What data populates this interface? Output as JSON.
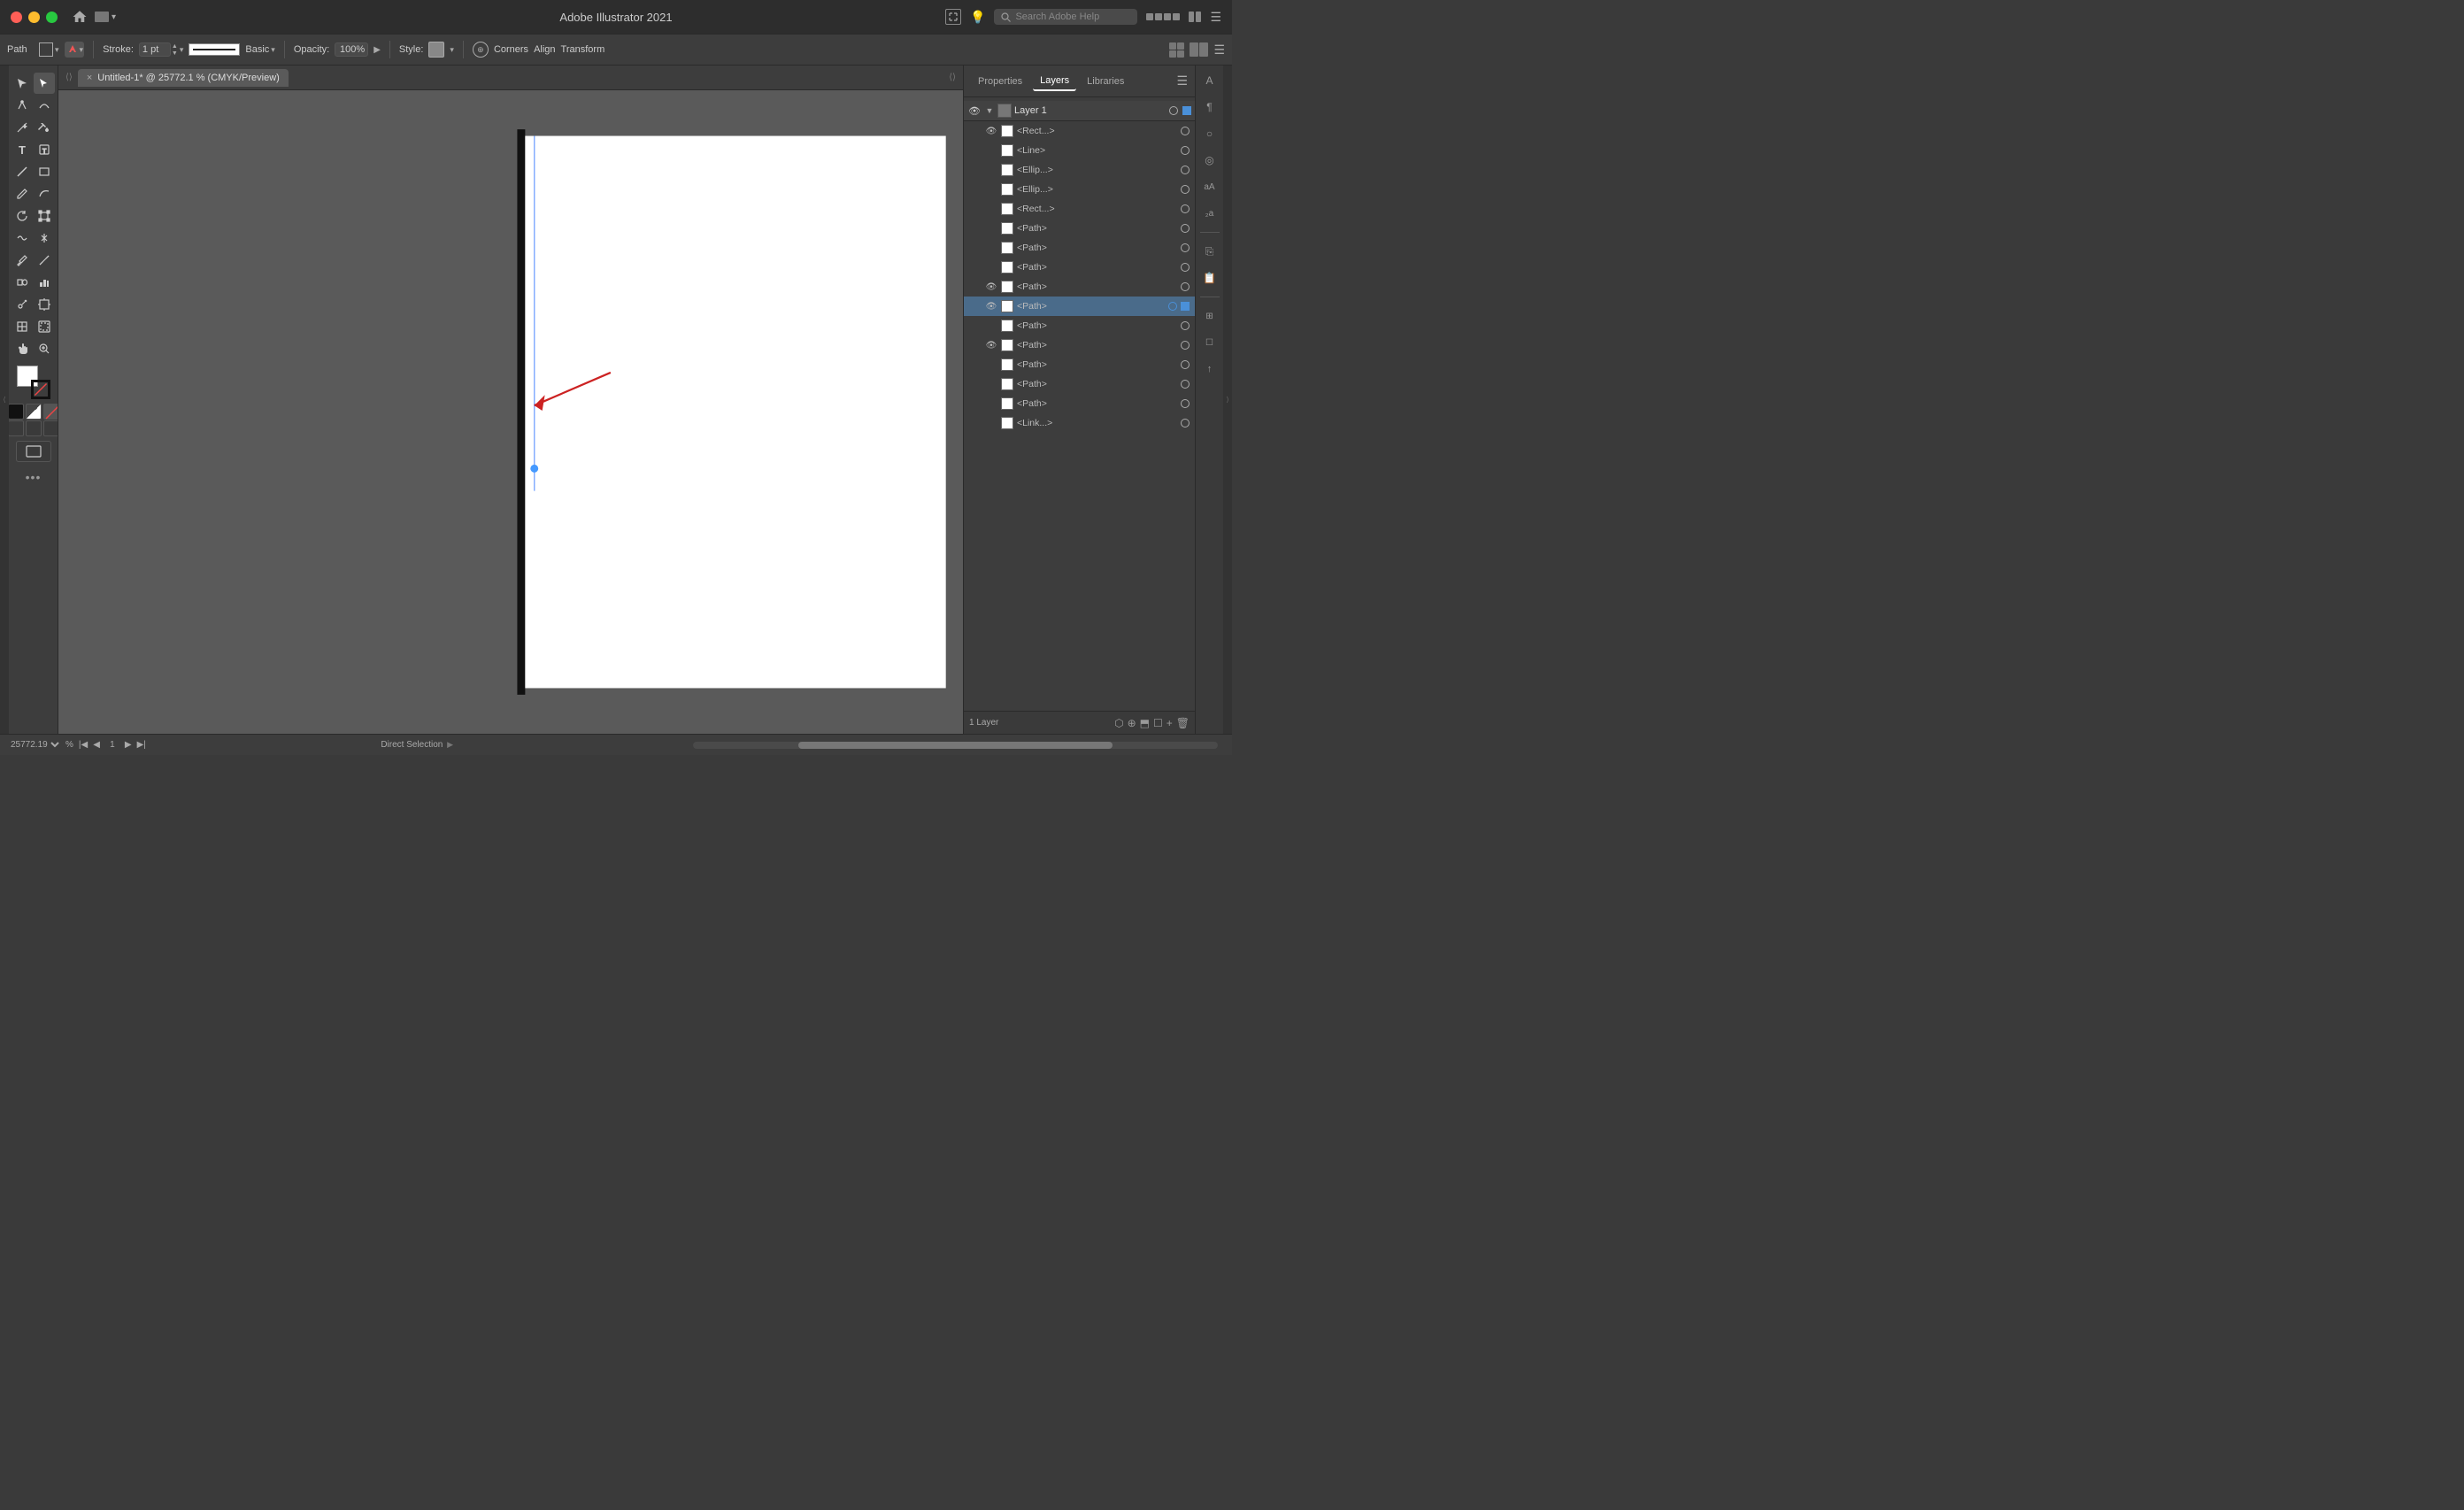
{
  "titlebar": {
    "title": "Adobe Illustrator 2021",
    "search_placeholder": "Search Adobe Help"
  },
  "toolbar": {
    "path_label": "Path",
    "stroke_label": "Stroke:",
    "basic_label": "Basic",
    "opacity_label": "Opacity:",
    "opacity_value": "100%",
    "style_label": "Style:",
    "corners_label": "Corners",
    "align_label": "Align",
    "transform_label": "Transform"
  },
  "tab": {
    "close_label": "×",
    "title": "Untitled-1* @ 25772.1 % (CMYK/Preview)"
  },
  "status_bar": {
    "zoom": "25772.19",
    "page": "1",
    "tool": "Direct Selection",
    "layer_count": "1 Layer"
  },
  "panels": {
    "properties": "Properties",
    "layers": "Layers",
    "libraries": "Libraries"
  },
  "layers": {
    "group_name": "Layer 1",
    "items": [
      {
        "name": "<Rect...",
        "visible": true,
        "selected": false
      },
      {
        "name": "<Line>",
        "visible": false,
        "selected": false
      },
      {
        "name": "<Ellip...",
        "visible": false,
        "selected": false
      },
      {
        "name": "<Ellip...",
        "visible": false,
        "selected": false
      },
      {
        "name": "<Rect...",
        "visible": false,
        "selected": false
      },
      {
        "name": "<Path>",
        "visible": false,
        "selected": false
      },
      {
        "name": "<Path>",
        "visible": false,
        "selected": false
      },
      {
        "name": "<Path>",
        "visible": false,
        "selected": false
      },
      {
        "name": "<Path>",
        "visible": true,
        "selected": false
      },
      {
        "name": "<Path>",
        "visible": true,
        "selected": true
      },
      {
        "name": "<Path>",
        "visible": false,
        "selected": false
      },
      {
        "name": "<Path>",
        "visible": true,
        "selected": false
      },
      {
        "name": "<Path>",
        "visible": false,
        "selected": false
      },
      {
        "name": "<Path>",
        "visible": false,
        "selected": false
      },
      {
        "name": "<Path>",
        "visible": false,
        "selected": false
      },
      {
        "name": "<Link...",
        "visible": false,
        "selected": false
      }
    ]
  }
}
